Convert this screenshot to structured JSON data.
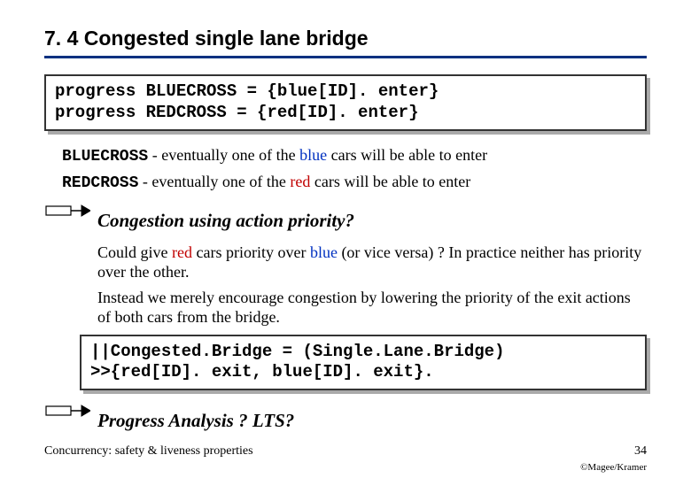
{
  "heading": "7. 4 Congested single lane bridge",
  "code1_line1": "progress BLUECROSS = {blue[ID]. enter}",
  "code1_line2": "progress REDCROSS =  {red[ID]. enter}",
  "bluecross_label": "BLUECROSS",
  "bluecross_text_a": " - eventually one of the ",
  "bluecross_text_b": "blue",
  "bluecross_text_c": " cars will be able to enter",
  "redcross_label": "REDCROSS",
  "redcross_text_a": "  - eventually one of the ",
  "redcross_text_b": "red",
  "redcross_text_c": " cars will be able to enter",
  "congestion_heading": "Congestion using action priority?",
  "body_a": "Could give ",
  "body_b": "red",
  "body_c": " cars priority over ",
  "body_d": "blue",
  "body_e": " (or vice versa) ?        In practice neither has priority over the other.",
  "body2": "Instead we merely encourage congestion by lowering the priority of the exit actions of both cars from the bridge.",
  "code2_line1": "||Congested.Bridge = (Single.Lane.Bridge)",
  "code2_line2": "                 >>{red[ID]. exit, blue[ID]. exit}.",
  "progress_heading": "Progress Analysis ?   LTS?",
  "footer_left": "Concurrency: safety & liveness properties",
  "footer_right": "34",
  "copyright": "©Magee/Kramer"
}
